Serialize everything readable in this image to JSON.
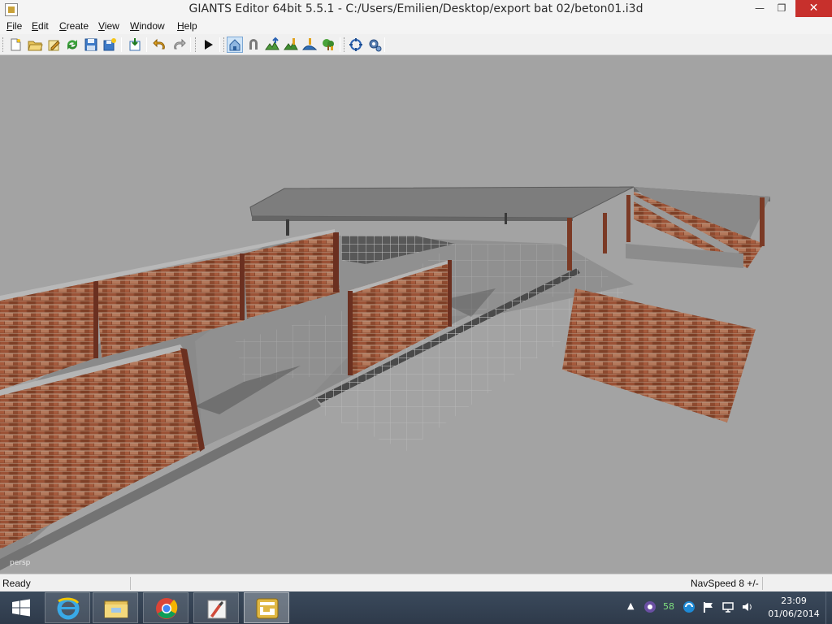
{
  "window": {
    "title": "GIANTS Editor 64bit 5.5.1 - C:/Users/Emilien/Desktop/export bat 02/beton01.i3d",
    "minimize_glyph": "—",
    "maximize_glyph": "❐",
    "close_glyph": "✕"
  },
  "menu": [
    {
      "label": "File",
      "accel": "F",
      "rest": "ile"
    },
    {
      "label": "Edit",
      "accel": "E",
      "rest": "dit"
    },
    {
      "label": "Create",
      "accel": "C",
      "rest": "reate"
    },
    {
      "label": "View",
      "accel": "V",
      "rest": "iew"
    },
    {
      "label": "Window",
      "accel": "W",
      "rest": "indow"
    },
    {
      "label": "Help",
      "accel": "H",
      "rest": "elp"
    }
  ],
  "toolbar": {
    "buttons": [
      {
        "icon": "new-file-icon"
      },
      {
        "icon": "open-folder-icon"
      },
      {
        "icon": "edit-icon"
      },
      {
        "icon": "refresh-icon"
      },
      {
        "icon": "save-icon"
      },
      {
        "icon": "save-as-icon"
      },
      {
        "icon": "import-icon"
      },
      {
        "icon": "undo-icon"
      },
      {
        "icon": "redo-icon"
      },
      {
        "icon": "play-icon"
      },
      {
        "icon": "home-icon"
      },
      {
        "icon": "magnet-icon"
      },
      {
        "icon": "terrain-raise-icon"
      },
      {
        "icon": "terrain-paint-icon"
      },
      {
        "icon": "terrain-smooth-icon"
      },
      {
        "icon": "foliage-icon"
      },
      {
        "icon": "transform-icon"
      },
      {
        "icon": "settings-gear-icon"
      }
    ]
  },
  "viewport": {
    "camera_label": "persp",
    "background": "#a3a3a3"
  },
  "status": {
    "text": "Ready",
    "navspeed": "NavSpeed 8 +/-"
  },
  "taskbar": {
    "apps": [
      {
        "icon": "internet-explorer-icon"
      },
      {
        "icon": "file-explorer-icon"
      },
      {
        "icon": "chrome-icon"
      },
      {
        "icon": "paint-app-icon"
      },
      {
        "icon": "giants-editor-icon"
      }
    ],
    "tray": {
      "badge": "58"
    },
    "clock": {
      "time": "23:09",
      "date": "01/06/2014"
    }
  }
}
